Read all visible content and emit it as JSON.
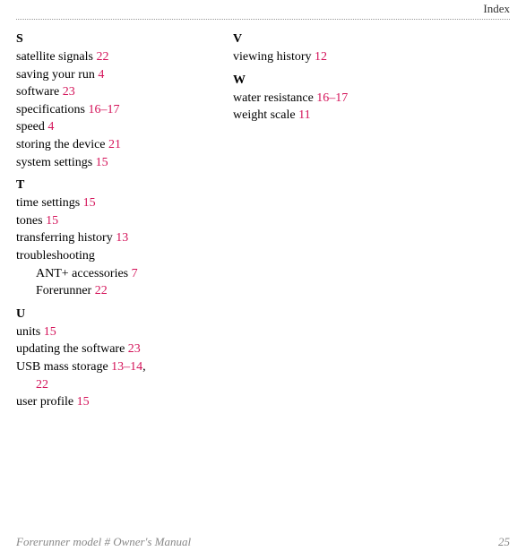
{
  "header": {
    "section_label": "Index"
  },
  "columns": [
    {
      "sections": [
        {
          "heading": "S",
          "entries": [
            {
              "label": "satellite signals ",
              "page": "22"
            },
            {
              "label": "saving your run ",
              "page": "4"
            },
            {
              "label": "software ",
              "page": "23"
            },
            {
              "label": "specifications ",
              "page": "16–17"
            },
            {
              "label": "speed ",
              "page": "4"
            },
            {
              "label": "storing the device ",
              "page": "21"
            },
            {
              "label": "system settings ",
              "page": "15"
            }
          ]
        },
        {
          "heading": "T",
          "entries": [
            {
              "label": "time settings ",
              "page": "15"
            },
            {
              "label": "tones ",
              "page": "15"
            },
            {
              "label": "transferring history ",
              "page": "13"
            },
            {
              "label": "troubleshooting",
              "page": ""
            },
            {
              "label": "ANT+ accessories ",
              "page": "7",
              "sub": true
            },
            {
              "label": "Forerunner ",
              "page": "22",
              "sub": true
            }
          ]
        },
        {
          "heading": "U",
          "entries": [
            {
              "label": "units ",
              "page": "15"
            },
            {
              "label": "updating the software ",
              "page": "23"
            },
            {
              "label": "USB mass storage ",
              "page": "13–14"
            },
            {
              "label": "",
              "page": "22",
              "sub": true,
              "trailing_comma_prev": true
            },
            {
              "label": "user profile ",
              "page": "15"
            }
          ]
        }
      ]
    },
    {
      "sections": [
        {
          "heading": "V",
          "entries": [
            {
              "label": "viewing history ",
              "page": "12"
            }
          ]
        },
        {
          "heading": "W",
          "entries": [
            {
              "label": "water resistance ",
              "page": "16–17"
            },
            {
              "label": "weight scale ",
              "page": "11"
            }
          ]
        }
      ]
    }
  ],
  "footer": {
    "left": "Forerunner model # Owner's Manual",
    "right": "25"
  }
}
